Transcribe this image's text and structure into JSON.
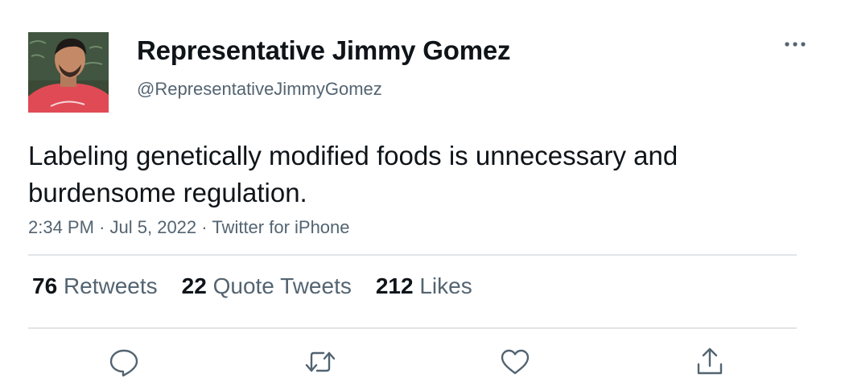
{
  "tweet": {
    "author": {
      "name": "Representative Jimmy Gomez",
      "handle": "@RepresentativeJimmyGomez",
      "avatar": "profile-photo"
    },
    "text": "Labeling genetically modified foods is unnecessary and burdensome regulation.",
    "time": "2:34 PM",
    "date": "Jul 5, 2022",
    "source": "Twitter for iPhone",
    "separator": "·",
    "stats": {
      "retweets": {
        "count": "76",
        "label": "Retweets"
      },
      "quote_tweets": {
        "count": "22",
        "label": "Quote Tweets"
      },
      "likes": {
        "count": "212",
        "label": "Likes"
      }
    }
  },
  "actions": {
    "reply_icon": "reply-icon",
    "retweet_icon": "retweet-icon",
    "like_icon": "heart-icon",
    "share_icon": "share-icon",
    "more_icon": "more-options-icon"
  },
  "colors": {
    "text": "#0f1419",
    "secondary": "#536471",
    "divider": "#e1e5e8"
  }
}
